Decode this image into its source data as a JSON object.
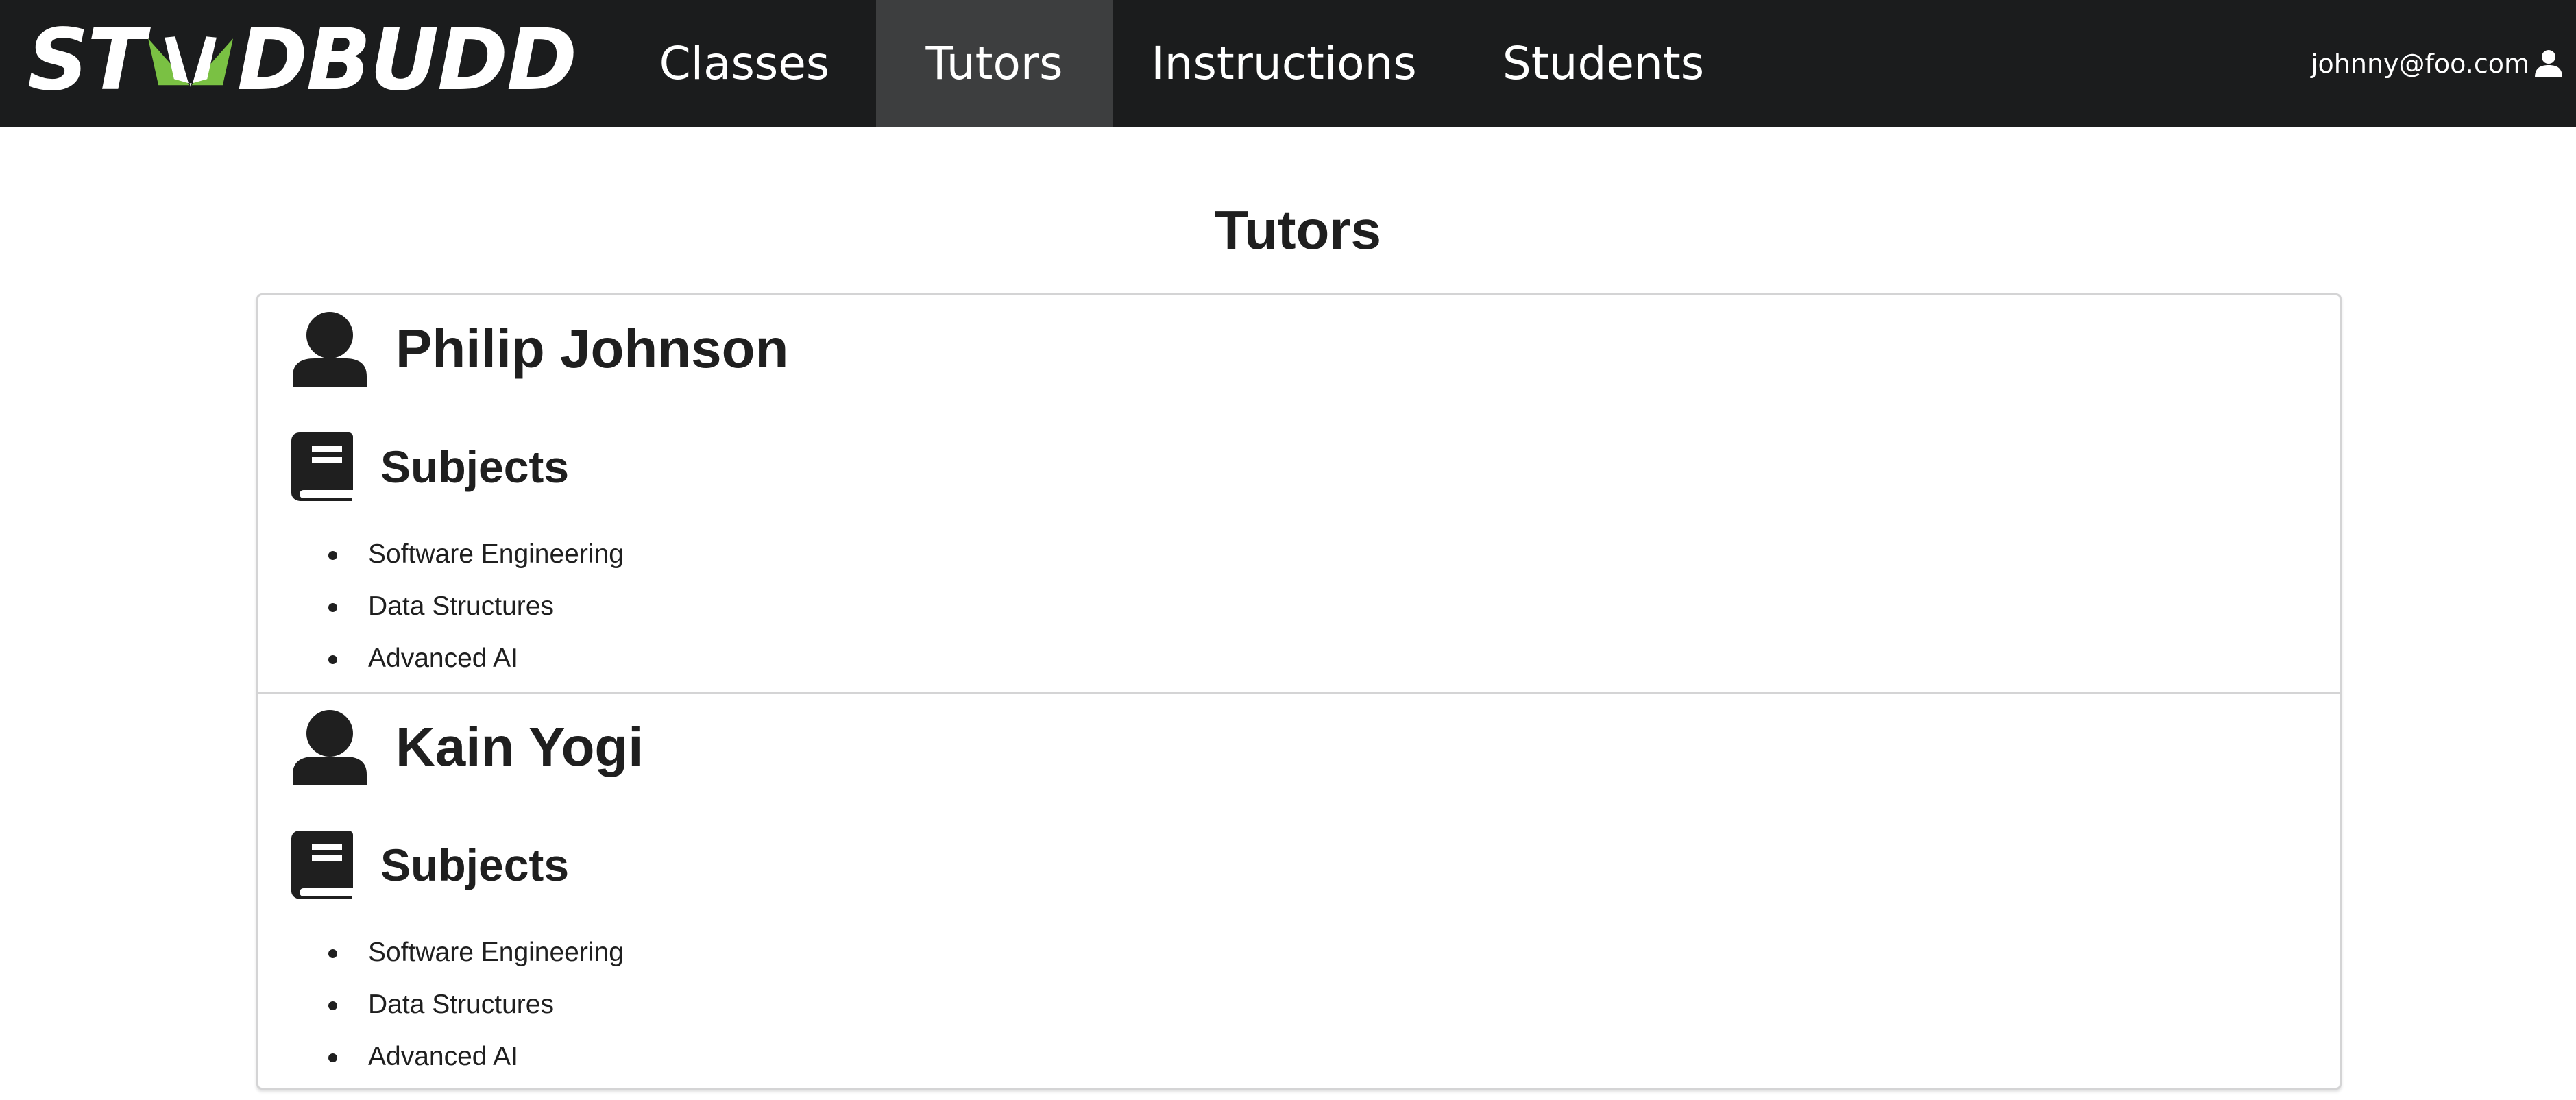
{
  "brand": {
    "logo_text_left": "ST",
    "logo_text_right": "DBUDD",
    "logo_green": "#7ac143",
    "logo_white": "#ffffff"
  },
  "nav": {
    "items": [
      {
        "label": "Classes",
        "active": false
      },
      {
        "label": "Tutors",
        "active": true
      },
      {
        "label": "Instructions",
        "active": false
      },
      {
        "label": "Students",
        "active": false
      }
    ],
    "user_email": "johnny@foo.com",
    "background": "#1b1c1d",
    "active_background": "#3d3e3f"
  },
  "page": {
    "title": "Tutors"
  },
  "tutors": [
    {
      "name": "Philip Johnson",
      "subjects_label": "Subjects",
      "subjects": [
        "Software Engineering",
        "Data Structures",
        "Advanced AI"
      ]
    },
    {
      "name": "Kain Yogi",
      "subjects_label": "Subjects",
      "subjects": [
        "Software Engineering",
        "Data Structures",
        "Advanced AI"
      ]
    }
  ],
  "icons": {
    "user": "user-icon",
    "book": "book-icon"
  }
}
